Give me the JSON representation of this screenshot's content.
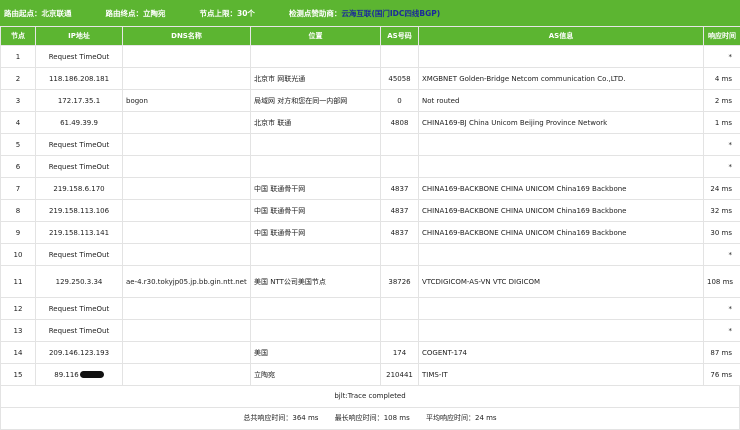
{
  "header": {
    "start_label": "路由起点：",
    "start_value": "北京联通",
    "end_label": "路由终点：",
    "end_value": "立陶宛",
    "hops_label": "节点上限：",
    "hops_value": "30个",
    "sponsor_label": "检测点赞助商：",
    "sponsor_name": "云海互联",
    "sponsor_tag": "(国门IDC四线BGP)"
  },
  "columns": [
    "节点",
    "IP地址",
    "DNS名称",
    "位置",
    "AS号码",
    "AS信息",
    "响应时间"
  ],
  "rows": [
    {
      "hop": "1",
      "ip": "Request TimeOut",
      "dns": "",
      "loc": "",
      "as": "",
      "asinfo": "",
      "time": "*"
    },
    {
      "hop": "2",
      "ip": "118.186.208.181",
      "dns": "",
      "loc": "北京市 网联光通",
      "as": "45058",
      "asinfo": "XMGBNET Golden-Bridge Netcom communication Co.,LTD.",
      "time": "4 ms"
    },
    {
      "hop": "3",
      "ip": "172.17.35.1",
      "dns": "bogon",
      "loc": "局域网 对方和您在同一内部网",
      "as": "0",
      "asinfo": "Not routed",
      "time": "2 ms"
    },
    {
      "hop": "4",
      "ip": "61.49.39.9",
      "dns": "",
      "loc": "北京市 联通",
      "as": "4808",
      "asinfo": "CHINA169-BJ China Unicom Beijing Province Network",
      "time": "1 ms"
    },
    {
      "hop": "5",
      "ip": "Request TimeOut",
      "dns": "",
      "loc": "",
      "as": "",
      "asinfo": "",
      "time": "*"
    },
    {
      "hop": "6",
      "ip": "Request TimeOut",
      "dns": "",
      "loc": "",
      "as": "",
      "asinfo": "",
      "time": "*"
    },
    {
      "hop": "7",
      "ip": "219.158.6.170",
      "dns": "",
      "loc": "中国 联通骨干网",
      "as": "4837",
      "asinfo": "CHINA169-BACKBONE CHINA UNICOM China169 Backbone",
      "time": "24 ms"
    },
    {
      "hop": "8",
      "ip": "219.158.113.106",
      "dns": "",
      "loc": "中国 联通骨干网",
      "as": "4837",
      "asinfo": "CHINA169-BACKBONE CHINA UNICOM China169 Backbone",
      "time": "32 ms"
    },
    {
      "hop": "9",
      "ip": "219.158.113.141",
      "dns": "",
      "loc": "中国 联通骨干网",
      "as": "4837",
      "asinfo": "CHINA169-BACKBONE CHINA UNICOM China169 Backbone",
      "time": "30 ms"
    },
    {
      "hop": "10",
      "ip": "Request TimeOut",
      "dns": "",
      "loc": "",
      "as": "",
      "asinfo": "",
      "time": "*"
    },
    {
      "hop": "11",
      "ip": "129.250.3.34",
      "dns": "ae-4.r30.tokyjp05.jp.bb.gin.ntt.net",
      "loc": "美国 NTT公司美国节点",
      "as": "38726",
      "asinfo": "VTCDIGICOM-AS-VN VTC DIGICOM",
      "time": "108 ms"
    },
    {
      "hop": "12",
      "ip": "Request TimeOut",
      "dns": "",
      "loc": "",
      "as": "",
      "asinfo": "",
      "time": "*"
    },
    {
      "hop": "13",
      "ip": "Request TimeOut",
      "dns": "",
      "loc": "",
      "as": "",
      "asinfo": "",
      "time": "*"
    },
    {
      "hop": "14",
      "ip": "209.146.123.193",
      "dns": "",
      "loc": "美国",
      "as": "174",
      "asinfo": "COGENT-174",
      "time": "87 ms"
    },
    {
      "hop": "15",
      "ip": "89.116",
      "dns": "",
      "loc": "立陶宛",
      "as": "210441",
      "asinfo": "TIMS-IT",
      "time": "76 ms"
    }
  ],
  "footer": {
    "completed": "bjlt:Trace completed",
    "total_label": "总共响应时间：",
    "total_value": "364 ms",
    "max_label": "最长响应时间：",
    "max_value": "108 ms",
    "avg_label": "平均响应时间：",
    "avg_value": "24 ms"
  }
}
